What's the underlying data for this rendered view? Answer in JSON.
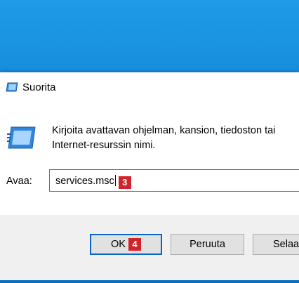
{
  "dialog": {
    "title": "Suorita",
    "prompt_line1": "Kirjoita avattavan ohjelman, kansion, tiedoston tai",
    "prompt_line2": "Internet-resurssin nimi.",
    "open_label": "Avaa:",
    "open_value": "services.msc",
    "open_step": "3",
    "ok_label": "OK",
    "ok_step": "4",
    "cancel_label": "Peruuta",
    "browse_label": "Selaa"
  },
  "colors": {
    "desktop": "#1486d6",
    "accent": "#0a64c8",
    "step_badge": "#d2232a"
  },
  "icons": {
    "title": "run-dialog-icon",
    "run": "run-program-icon"
  }
}
